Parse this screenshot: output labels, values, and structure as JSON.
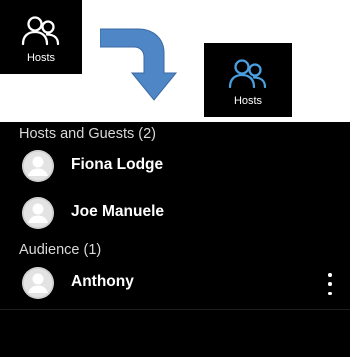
{
  "colors": {
    "accent": "#4a9fe0",
    "panel_bg": "#000000",
    "avatar_bg": "#e3e3e3",
    "arrow_fill": "#4f86c6"
  },
  "hosts_tile_before": {
    "label": "Hosts",
    "icon": "people-icon",
    "icon_color": "#ffffff"
  },
  "hosts_tile_after": {
    "label": "Hosts",
    "icon": "people-icon",
    "icon_color": "#4a9fe0"
  },
  "participants": {
    "sections": [
      {
        "title": "Hosts and Guests (2)",
        "members": [
          {
            "name": "Fiona Lodge"
          },
          {
            "name": "Joe Manuele"
          }
        ]
      },
      {
        "title": "Audience (1)",
        "members": [
          {
            "name": "Anthony",
            "menu_icon": "more-vertical-icon"
          }
        ]
      }
    ]
  }
}
